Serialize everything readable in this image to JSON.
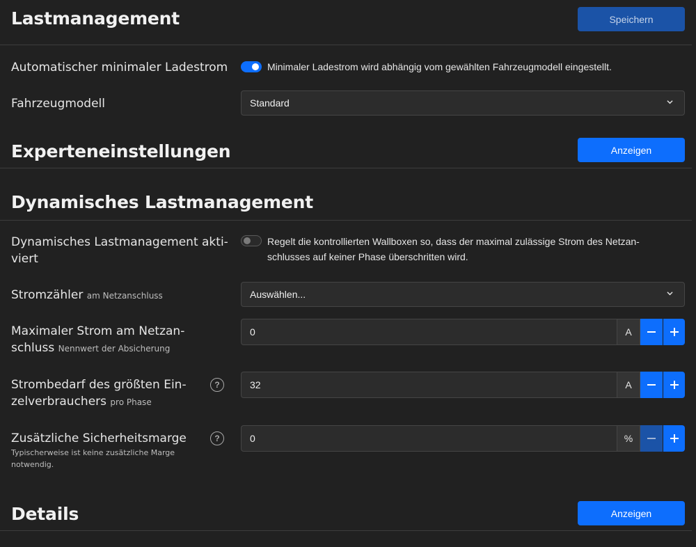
{
  "header": {
    "title": "Lastmanagement",
    "save_label": "Speichern"
  },
  "auto_min_current": {
    "label": "Automatischer minimaler Ladestrom",
    "enabled": true,
    "description": "Minimaler Ladestrom wird abhängig vom gewählten Fahrzeugmodell eingestellt."
  },
  "vehicle_model": {
    "label": "Fahrzeugmodell",
    "selected": "Standard"
  },
  "expert": {
    "title": "Experteneinstellungen",
    "show_label": "Anzeigen"
  },
  "dynamic": {
    "title": "Dynamisches Lastmanagement",
    "activated": {
      "label_line1": "Dynamisches Lastmanagement akti-",
      "label_line2": "viert",
      "enabled": false,
      "description_line1": "Regelt die kontrollierten Wallboxen so, dass der maximal zulässige Strom des Netzan-",
      "description_line2": "schlusses auf keiner Phase überschritten wird."
    },
    "meter": {
      "label": "Stromzähler",
      "sublabel": "am Netzanschluss",
      "selected": "Auswählen..."
    },
    "max_current": {
      "label_line1": "Maximaler Strom am Netzan-",
      "label_line2": "schluss",
      "sublabel": "Nennwert der Absicherung",
      "value": "0",
      "unit": "A"
    },
    "largest_consumer": {
      "label_line1": "Strombedarf des größten Ein-",
      "label_line2": "zelverbrauchers",
      "sublabel": "pro Phase",
      "value": "32",
      "unit": "A"
    },
    "safety_margin": {
      "label": "Zusätzliche Sicherheitsmarge",
      "sublabel_line1": "Typischerweise ist keine zusätzliche Marge",
      "sublabel_line2": "notwendig.",
      "value": "0",
      "unit": "%"
    }
  },
  "details": {
    "title": "Details",
    "show_label": "Anzeigen"
  },
  "icons": {
    "help": "question-circle-icon",
    "chevron": "chevron-down-icon",
    "minus": "minus-icon",
    "plus": "plus-icon"
  },
  "colors": {
    "background": "#212121",
    "primary": "#0d6efd",
    "primary_disabled": "#1b53a7"
  }
}
